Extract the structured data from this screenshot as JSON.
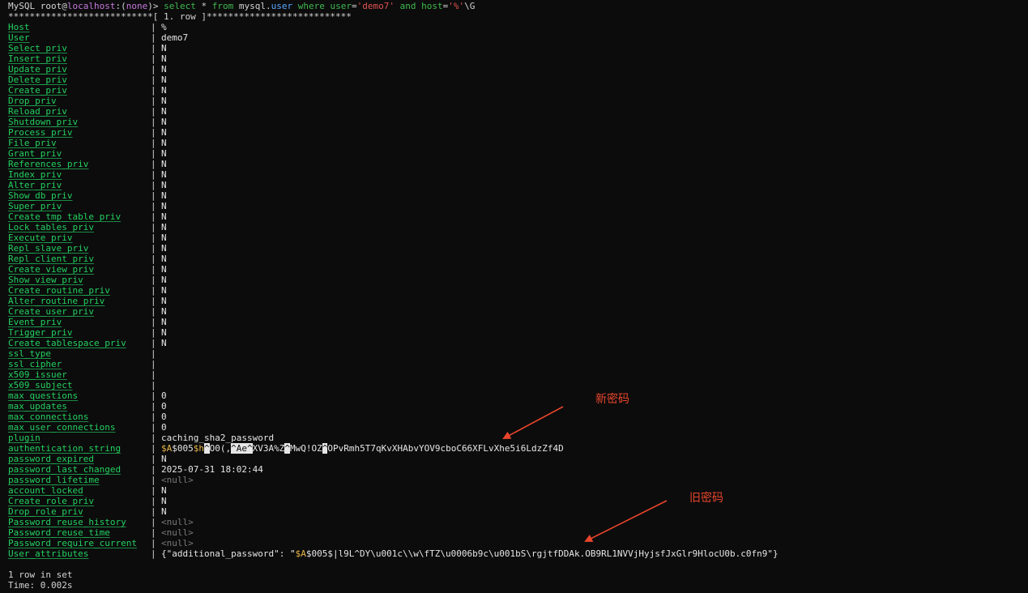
{
  "prompt": {
    "mysql": "MySQL",
    "user": "root",
    "at": "@",
    "host": "localhost",
    "colon": ":(",
    "db": "none",
    "close": ")>",
    "cmd_select": " select",
    "cmd_star": " * ",
    "cmd_from": "from",
    "cmd_table": " mysql",
    "cmd_dot": ".",
    "cmd_user": "user",
    "cmd_where": " where",
    "cmd_user2": " user",
    "cmd_eq": "=",
    "cmd_val1": "'demo7'",
    "cmd_and": " and",
    "cmd_host": " host",
    "cmd_eq2": "=",
    "cmd_val2": "'%'",
    "cmd_end": "\\G"
  },
  "separator": "***************************[ 1. row ]***************************",
  "fields": [
    {
      "name": "Host",
      "value": "%"
    },
    {
      "name": "User",
      "value": "demo7"
    },
    {
      "name": "Select_priv",
      "value": "N"
    },
    {
      "name": "Insert_priv",
      "value": "N"
    },
    {
      "name": "Update_priv",
      "value": "N"
    },
    {
      "name": "Delete_priv",
      "value": "N"
    },
    {
      "name": "Create_priv",
      "value": "N"
    },
    {
      "name": "Drop_priv",
      "value": "N"
    },
    {
      "name": "Reload_priv",
      "value": "N"
    },
    {
      "name": "Shutdown_priv",
      "value": "N"
    },
    {
      "name": "Process_priv",
      "value": "N"
    },
    {
      "name": "File_priv",
      "value": "N"
    },
    {
      "name": "Grant_priv",
      "value": "N"
    },
    {
      "name": "References_priv",
      "value": "N"
    },
    {
      "name": "Index_priv",
      "value": "N"
    },
    {
      "name": "Alter_priv",
      "value": "N"
    },
    {
      "name": "Show_db_priv",
      "value": "N"
    },
    {
      "name": "Super_priv",
      "value": "N"
    },
    {
      "name": "Create_tmp_table_priv",
      "value": "N"
    },
    {
      "name": "Lock_tables_priv",
      "value": "N"
    },
    {
      "name": "Execute_priv",
      "value": "N"
    },
    {
      "name": "Repl_slave_priv",
      "value": "N"
    },
    {
      "name": "Repl_client_priv",
      "value": "N"
    },
    {
      "name": "Create_view_priv",
      "value": "N"
    },
    {
      "name": "Show_view_priv",
      "value": "N"
    },
    {
      "name": "Create_routine_priv",
      "value": "N"
    },
    {
      "name": "Alter_routine_priv",
      "value": "N"
    },
    {
      "name": "Create_user_priv",
      "value": "N"
    },
    {
      "name": "Event_priv",
      "value": "N"
    },
    {
      "name": "Trigger_priv",
      "value": "N"
    },
    {
      "name": "Create_tablespace_priv",
      "value": "N"
    },
    {
      "name": "ssl_type",
      "value": ""
    },
    {
      "name": "ssl_cipher",
      "value": ""
    },
    {
      "name": "x509_issuer",
      "value": ""
    },
    {
      "name": "x509_subject",
      "value": ""
    },
    {
      "name": "max_questions",
      "value": "0"
    },
    {
      "name": "max_updates",
      "value": "0"
    },
    {
      "name": "max_connections",
      "value": "0"
    },
    {
      "name": "max_user_connections",
      "value": "0"
    },
    {
      "name": "plugin",
      "value": "caching_sha2_password"
    },
    {
      "name": "authentication_string",
      "value": ""
    },
    {
      "name": "password_expired",
      "value": "N"
    },
    {
      "name": "password_last_changed",
      "value": "2025-07-31 18:02:44"
    },
    {
      "name": "password_lifetime",
      "value": "<null>",
      "null": true
    },
    {
      "name": "account_locked",
      "value": "N"
    },
    {
      "name": "Create_role_priv",
      "value": "N"
    },
    {
      "name": "Drop_role_priv",
      "value": "N"
    },
    {
      "name": "Password_reuse_history",
      "value": "<null>",
      "null": true
    },
    {
      "name": "Password_reuse_time",
      "value": "<null>",
      "null": true
    },
    {
      "name": "Password_require_current",
      "value": "<null>",
      "null": true
    },
    {
      "name": "User_attributes",
      "value": ""
    }
  ],
  "auth_string": {
    "p1": "$A",
    "p2": "$005",
    "p3": "$h",
    "p4": "^",
    "p5": "O0(,",
    "p6": "^A",
    "p7": "e",
    "p8": "^",
    "p9": "XV3A%Z",
    "p10": "^",
    "p11": "MwQ!OZ",
    "p12": "^",
    "p13": "OPvRmh5T7qKvXHAbvYOV9cboC66XFLvXhe5i6LdzZf4D"
  },
  "user_attributes": {
    "prefix": "{\"additional_password\": \"",
    "gold": "$A",
    "rest": "$005$|l9L^DY\\u001c\\\\w\\fTZ\\u0006b9c\\u001bS\\rgjtfDDAk.OB9RL1NVVjHyjsfJxGlr9HlocU0b.c0fn9\"}"
  },
  "footer": {
    "rows": "1 row in set",
    "time": "Time: 0.002s"
  },
  "annotations": {
    "new_password": "新密码",
    "old_password": "旧密码"
  },
  "colors": {
    "field_name": "#23d160",
    "annotation": "#e8452c",
    "background": "#0c0c0c"
  }
}
